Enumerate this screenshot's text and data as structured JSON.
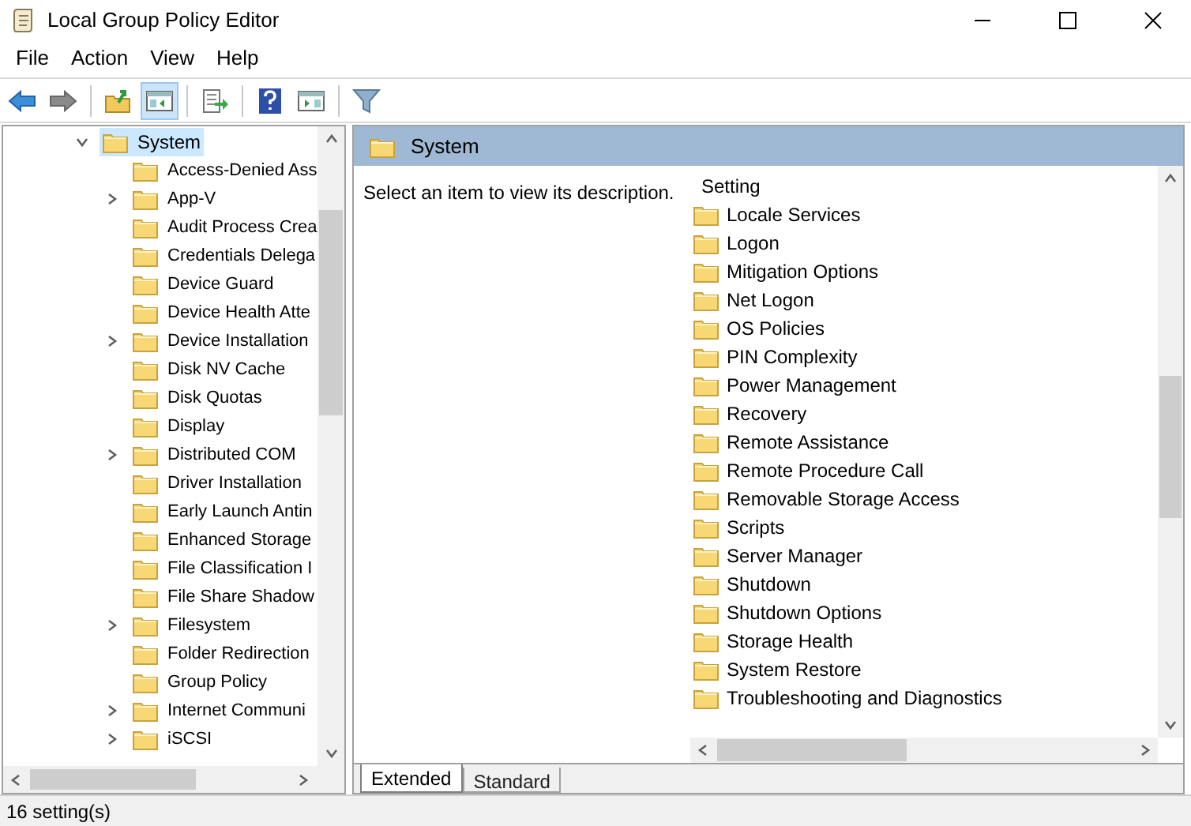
{
  "window": {
    "title": "Local Group Policy Editor"
  },
  "menu": [
    "File",
    "Action",
    "View",
    "Help"
  ],
  "toolbar": [
    {
      "kind": "back",
      "pressed": false
    },
    {
      "kind": "forward",
      "pressed": false
    },
    {
      "kind": "sep"
    },
    {
      "kind": "up",
      "pressed": false
    },
    {
      "kind": "tree",
      "pressed": true
    },
    {
      "kind": "sep"
    },
    {
      "kind": "export",
      "pressed": false
    },
    {
      "kind": "sep"
    },
    {
      "kind": "help",
      "pressed": false
    },
    {
      "kind": "pane",
      "pressed": false
    },
    {
      "kind": "sep"
    },
    {
      "kind": "filter",
      "pressed": false
    }
  ],
  "tree": {
    "label": "System",
    "expanded": true,
    "selected": true,
    "children": [
      {
        "label": "Access-Denied Ass",
        "expandable": false
      },
      {
        "label": "App-V",
        "expandable": true
      },
      {
        "label": "Audit Process Crea",
        "expandable": false
      },
      {
        "label": "Credentials Delega",
        "expandable": false
      },
      {
        "label": "Device Guard",
        "expandable": false
      },
      {
        "label": "Device Health Atte",
        "expandable": false
      },
      {
        "label": "Device Installation",
        "expandable": true
      },
      {
        "label": "Disk NV Cache",
        "expandable": false
      },
      {
        "label": "Disk Quotas",
        "expandable": false
      },
      {
        "label": "Display",
        "expandable": false
      },
      {
        "label": "Distributed COM",
        "expandable": true
      },
      {
        "label": "Driver Installation",
        "expandable": false
      },
      {
        "label": "Early Launch Antin",
        "expandable": false
      },
      {
        "label": "Enhanced Storage",
        "expandable": false
      },
      {
        "label": "File Classification I",
        "expandable": false
      },
      {
        "label": "File Share Shadow",
        "expandable": false
      },
      {
        "label": "Filesystem",
        "expandable": true
      },
      {
        "label": "Folder Redirection",
        "expandable": false
      },
      {
        "label": "Group Policy",
        "expandable": false
      },
      {
        "label": "Internet Communi",
        "expandable": true
      },
      {
        "label": "iSCSI",
        "expandable": true
      }
    ]
  },
  "details": {
    "header": "System",
    "description": "Select an item to view its description.",
    "column": "Setting",
    "items": [
      "Locale Services",
      "Logon",
      "Mitigation Options",
      "Net Logon",
      "OS Policies",
      "PIN Complexity",
      "Power Management",
      "Recovery",
      "Remote Assistance",
      "Remote Procedure Call",
      "Removable Storage Access",
      "Scripts",
      "Server Manager",
      "Shutdown",
      "Shutdown Options",
      "Storage Health",
      "System Restore",
      "Troubleshooting and Diagnostics"
    ]
  },
  "tabs": [
    {
      "label": "Extended",
      "selected": true
    },
    {
      "label": "Standard",
      "selected": false
    }
  ],
  "status_bar": "16 setting(s)"
}
